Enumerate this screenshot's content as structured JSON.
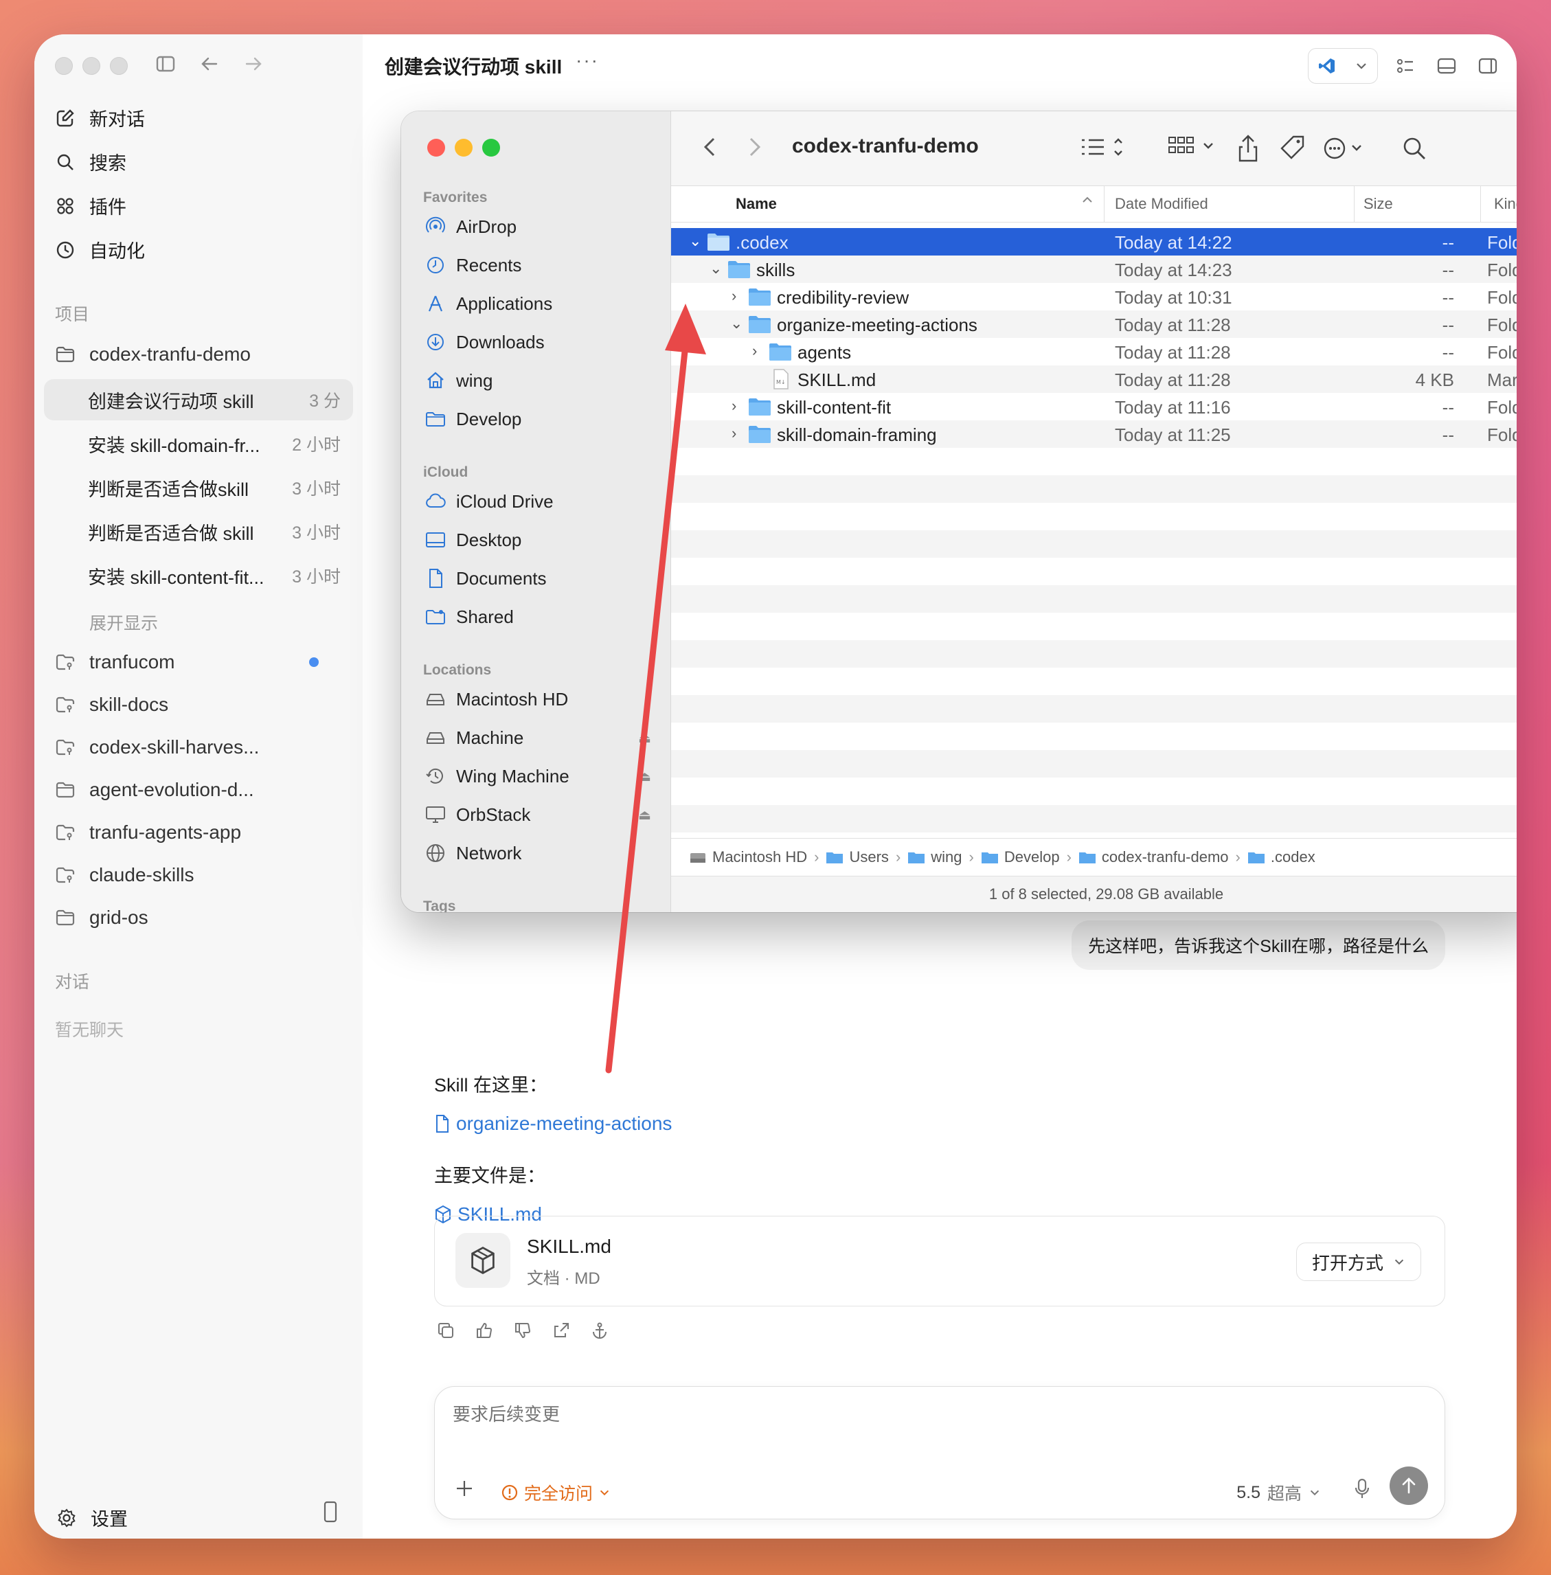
{
  "sidebar": {
    "nav": {
      "new_chat": "新对话",
      "search": "搜索",
      "plugins": "插件",
      "automation": "自动化"
    },
    "projects_label": "项目",
    "current_project": "codex-tranfu-demo",
    "threads": [
      {
        "title": "创建会议行动项 skill",
        "time": "3 分"
      },
      {
        "title": "安装 skill-domain-fr...",
        "time": "2 小时"
      },
      {
        "title": "判断是否适合做skill",
        "time": "3 小时"
      },
      {
        "title": "判断是否适合做 skill",
        "time": "3 小时"
      },
      {
        "title": "安装 skill-content-fit...",
        "time": "3 小时"
      }
    ],
    "expand_label": "展开显示",
    "other_projects": [
      "tranfucom",
      "skill-docs",
      "codex-skill-harves...",
      "agent-evolution-d...",
      "tranfu-agents-app",
      "claude-skills",
      "grid-os"
    ],
    "conversations_label": "对话",
    "no_chats": "暂无聊天",
    "settings": "设置"
  },
  "topbar": {
    "title": "创建会议行动项 skill",
    "more": "···"
  },
  "finder": {
    "title": "codex-tranfu-demo",
    "sections": {
      "favorites": "Favorites",
      "icloud": "iCloud",
      "locations": "Locations",
      "tags": "Tags"
    },
    "favorites": [
      "AirDrop",
      "Recents",
      "Applications",
      "Downloads",
      "wing",
      "Develop"
    ],
    "icloud": [
      "iCloud Drive",
      "Desktop",
      "Documents",
      "Shared"
    ],
    "locations": [
      "Macintosh HD",
      "Machine",
      "Wing Machine",
      "OrbStack",
      "Network"
    ],
    "columns": {
      "name": "Name",
      "date": "Date Modified",
      "size": "Size",
      "kind": "Kind"
    },
    "rows": [
      {
        "name": ".codex",
        "date": "Today at 14:22",
        "size": "--",
        "kind": "Folde"
      },
      {
        "name": "skills",
        "date": "Today at 14:23",
        "size": "--",
        "kind": "Folde"
      },
      {
        "name": "credibility-review",
        "date": "Today at 10:31",
        "size": "--",
        "kind": "Folde"
      },
      {
        "name": "organize-meeting-actions",
        "date": "Today at 11:28",
        "size": "--",
        "kind": "Folde"
      },
      {
        "name": "agents",
        "date": "Today at 11:28",
        "size": "--",
        "kind": "Folde"
      },
      {
        "name": "SKILL.md",
        "date": "Today at 11:28",
        "size": "4 KB",
        "kind": "Marki"
      },
      {
        "name": "skill-content-fit",
        "date": "Today at 11:16",
        "size": "--",
        "kind": "Folde"
      },
      {
        "name": "skill-domain-framing",
        "date": "Today at 11:25",
        "size": "--",
        "kind": "Folde"
      }
    ],
    "path": [
      "Macintosh HD",
      "Users",
      "wing",
      "Develop",
      "codex-tranfu-demo",
      ".codex"
    ],
    "status": "1 of 8 selected, 29.08 GB available",
    "selection_color": "#2660d8"
  },
  "chat": {
    "user_message": "先这样吧，告诉我这个Skill在哪，路径是什么",
    "answer_intro": "Skill 在这里：",
    "folder_link": "organize-meeting-actions",
    "main_file_label": "主要文件是：",
    "file_link": "SKILL.md",
    "file_card": {
      "name": "SKILL.md",
      "meta": "文档 · MD",
      "open_with": "打开方式"
    }
  },
  "composer": {
    "placeholder": "要求后续变更",
    "access": "完全访问",
    "model": "5.5",
    "effort": "超高"
  },
  "colors": {
    "link": "#2f78d6",
    "access_warning": "#e26b1a",
    "annotation_arrow": "#e84848"
  }
}
